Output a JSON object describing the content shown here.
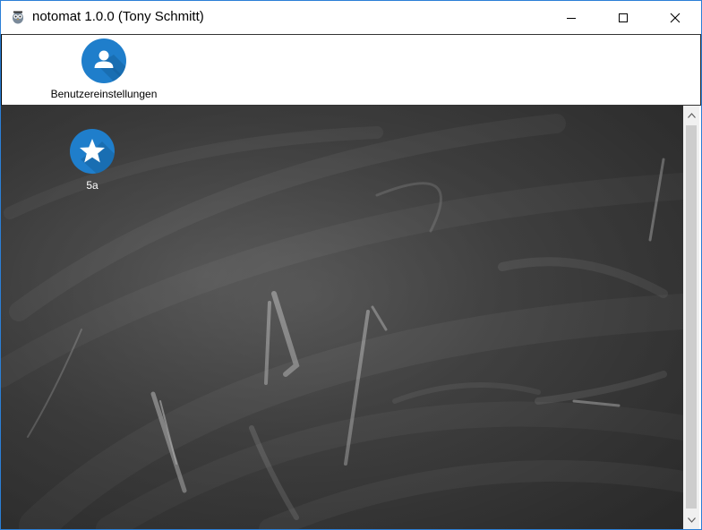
{
  "window": {
    "title": "notomat 1.0.0 (Tony Schmitt)",
    "border_color": "#2b7fd6"
  },
  "toolbar": {
    "user_settings_label": "Benutzereinstellungen",
    "user_settings_icon": "user-icon",
    "accent_color": "#1f7ecb"
  },
  "board": {
    "classes": [
      {
        "label": "5a",
        "icon": "star-icon"
      }
    ]
  },
  "caption_buttons": {
    "minimize_icon": "minimize-icon",
    "maximize_icon": "maximize-icon",
    "close_icon": "close-icon"
  }
}
